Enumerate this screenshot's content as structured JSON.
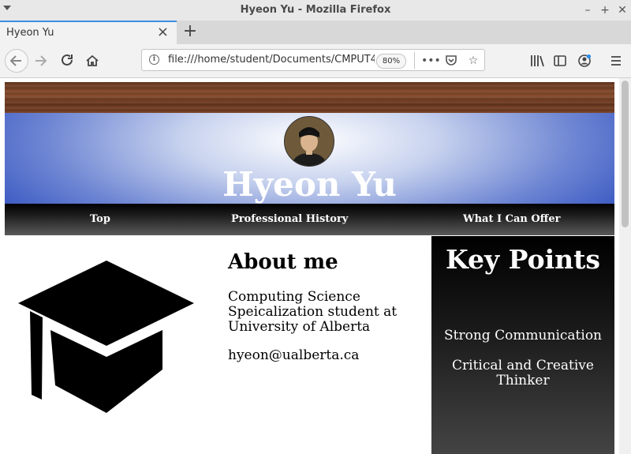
{
  "window": {
    "title": "Hyeon Yu - Mozilla Firefox"
  },
  "tab": {
    "label": "Hyeon Yu"
  },
  "toolbar": {
    "url": "file:///home/student/Documents/CMPUT4",
    "zoom": "80%"
  },
  "page": {
    "hero_name": "Hyeon Yu",
    "nav": [
      "Top",
      "Professional History",
      "What I Can Offer"
    ],
    "about": {
      "title": "About me",
      "description": "Computing Science Speicalization student at University of Alberta",
      "email": "hyeon@ualberta.ca"
    },
    "key_points": {
      "title": "Key Points",
      "items": [
        "Strong Communication",
        "Critical and Creative Thinker"
      ]
    }
  },
  "colors": {
    "hero_blue": "#1a3db8",
    "tab_accent": "#3b8ee0",
    "navbar_dark": "#000000"
  },
  "icons": [
    "window-menu-icon",
    "minimize-icon",
    "maximize-icon",
    "close-icon",
    "tab-close-icon",
    "new-tab-icon",
    "back-icon",
    "forward-icon",
    "reload-icon",
    "home-icon",
    "site-info-icon",
    "page-actions-icon",
    "pocket-icon",
    "bookmark-star-icon",
    "library-icon",
    "sidebar-icon",
    "account-icon",
    "hamburger-menu-icon",
    "graduation-cap-icon"
  ]
}
